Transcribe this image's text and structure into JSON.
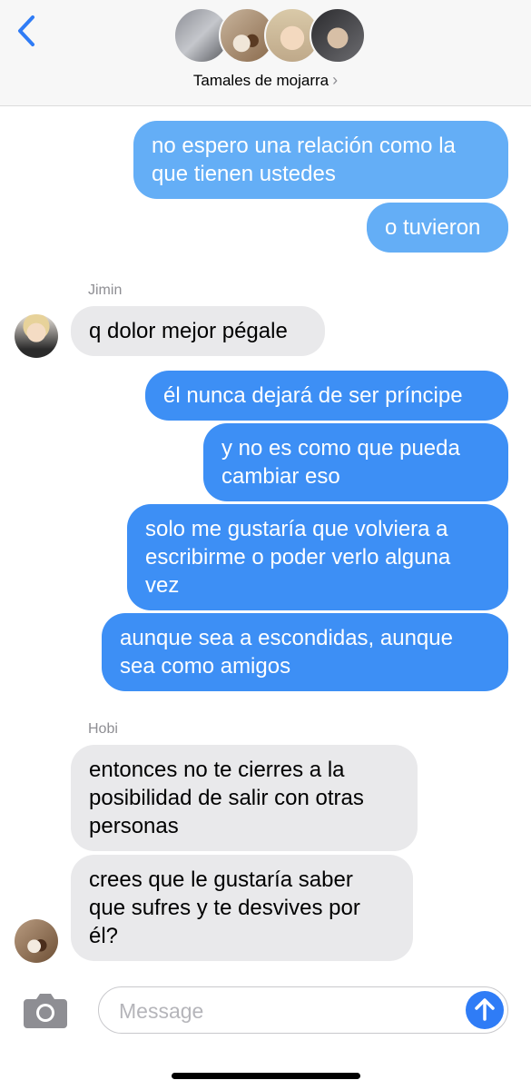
{
  "header": {
    "group_name": "Tamales de mojarra",
    "chevron": "›",
    "back_icon": "chevron-left-icon",
    "avatar_count": 4
  },
  "messages": [
    {
      "direction": "sent",
      "text": "no espero una relación como la que tienen ustedes"
    },
    {
      "direction": "sent",
      "text": "o tuvieron"
    },
    {
      "direction": "received",
      "sender": "Jimin",
      "text": "q dolor mejor pégale"
    },
    {
      "direction": "sent",
      "text": "él nunca dejará de ser príncipe"
    },
    {
      "direction": "sent",
      "text": "y no es como que pueda cambiar eso"
    },
    {
      "direction": "sent",
      "text": "solo me gustaría que volviera a escribirme o poder verlo alguna vez"
    },
    {
      "direction": "sent",
      "text": "aunque sea a escondidas, aunque sea como amigos"
    },
    {
      "direction": "received",
      "sender": "Hobi",
      "text": "entonces no te cierres a la posibilidad de salir con otras personas"
    },
    {
      "direction": "received",
      "sender": "Hobi",
      "text": "crees que le gustaría saber que sufres y te desvives por él?"
    }
  ],
  "input": {
    "placeholder": "Message",
    "value": ""
  },
  "colors": {
    "sent_bubble": "#3d8ff5",
    "sent_bubble_top": "#64aef6",
    "received_bubble": "#e9e9eb",
    "send_button": "#2f7cf6"
  }
}
